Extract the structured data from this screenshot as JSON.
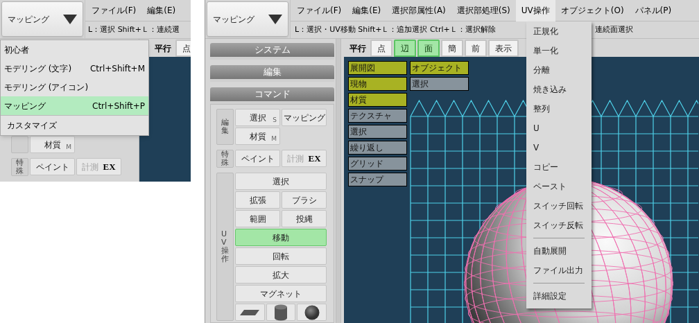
{
  "left_view": {
    "mode_button": {
      "label": "マッピング"
    },
    "menu_bar": [
      {
        "label": "ファイル(F)",
        "selected": false
      },
      {
        "label": "編集(E)",
        "selected": false
      }
    ],
    "status": [
      "L：選択  Shift+Ｌ：連続選"
    ],
    "view_tabs": [
      {
        "label": "平行",
        "kind": "label"
      },
      {
        "label": "点",
        "kind": "tab",
        "selected": false
      }
    ],
    "command_groups": [
      {
        "rows": [
          [
            {
              "label": "材質",
              "sub": "M",
              "kind": "text",
              "selected": false,
              "disabled": false
            }
          ]
        ]
      },
      {
        "label": "特殊",
        "rows": [
          [
            {
              "label": "ペイント",
              "kind": "text",
              "selected": false,
              "disabled": false
            },
            {
              "label": "計測",
              "badge": "EX",
              "kind": "text",
              "selected": false,
              "disabled": true
            }
          ]
        ]
      }
    ],
    "mode_menu": {
      "items": [
        {
          "label": "初心者",
          "selected": false
        },
        {
          "label": "モデリング (文字)",
          "shortcut": "Ctrl+Shift+M",
          "selected": false
        },
        {
          "label": "モデリング (アイコン)",
          "selected": false
        },
        {
          "label": "マッピング",
          "shortcut": "Ctrl+Shift+P",
          "selected": true
        }
      ],
      "footer": "カスタマイズ"
    }
  },
  "right_view": {
    "mode_button": {
      "label": "マッピング"
    },
    "menu_bar": [
      {
        "label": "ファイル(F)",
        "selected": false
      },
      {
        "label": "編集(E)",
        "selected": false
      },
      {
        "label": "選択部属性(A)",
        "selected": false
      },
      {
        "label": "選択部処理(S)",
        "selected": false
      },
      {
        "label": "UV操作",
        "selected": true
      },
      {
        "label": "オブジェクト(O)",
        "selected": false
      },
      {
        "label": "パネル(P)",
        "selected": false
      }
    ],
    "status": [
      "L：選択・UV移動  Shift+Ｌ：追加選択  Ctrl+Ｌ：選択解除",
      "連続面選択"
    ],
    "sidebar_sections": [
      "システム",
      "編集",
      "コマンド"
    ],
    "command_groups": [
      {
        "label": "編集",
        "rows": [
          [
            {
              "label": "選択",
              "sub": "S",
              "kind": "text",
              "selected": false,
              "disabled": false
            },
            {
              "label": "マッピング",
              "kind": "text",
              "selected": false,
              "disabled": false
            }
          ],
          [
            {
              "label": "材質",
              "sub": "M",
              "kind": "text",
              "selected": false,
              "disabled": false
            }
          ]
        ]
      },
      {
        "label": "特殊",
        "rows": [
          [
            {
              "label": "ペイント",
              "kind": "text",
              "selected": false,
              "disabled": false
            },
            {
              "label": "計測",
              "badge": "EX",
              "kind": "text",
              "selected": false,
              "disabled": true
            }
          ]
        ]
      },
      {
        "label": "UV操作",
        "rows": [
          [
            {
              "label": "選択",
              "wide": true,
              "kind": "text",
              "selected": false,
              "disabled": false
            }
          ],
          [
            {
              "label": "拡張",
              "kind": "text",
              "selected": false,
              "disabled": false
            },
            {
              "label": "ブラシ",
              "kind": "text",
              "selected": false,
              "disabled": false
            }
          ],
          [
            {
              "label": "範囲",
              "kind": "text",
              "selected": false,
              "disabled": false
            },
            {
              "label": "投縄",
              "kind": "text",
              "selected": false,
              "disabled": false
            }
          ],
          [
            {
              "label": "移動",
              "wide": true,
              "kind": "text",
              "selected": true,
              "disabled": false
            }
          ],
          [
            {
              "label": "回転",
              "wide": true,
              "kind": "text",
              "selected": false,
              "disabled": false
            }
          ],
          [
            {
              "label": "拡大",
              "wide": true,
              "kind": "text",
              "selected": false,
              "disabled": false
            }
          ],
          [
            {
              "label": "マグネット",
              "wide": true,
              "kind": "text",
              "selected": false,
              "disabled": false
            }
          ],
          [
            {
              "kind": "icon",
              "selected": false,
              "disabled": false
            },
            {
              "kind": "icon",
              "selected": false,
              "disabled": false
            },
            {
              "kind": "icon",
              "selected": false,
              "disabled": false
            }
          ]
        ]
      }
    ],
    "view_tabs": [
      {
        "label": "平行",
        "kind": "label"
      },
      {
        "label": "点",
        "kind": "tab",
        "selected": false
      },
      {
        "label": "辺",
        "kind": "tab",
        "selected": true
      },
      {
        "label": "面",
        "kind": "tab",
        "selected": true
      },
      {
        "label": "簡",
        "kind": "tab",
        "selected": false
      },
      {
        "label": "前",
        "kind": "tab",
        "selected": false
      },
      {
        "label": "表示",
        "kind": "tab",
        "selected": false
      }
    ],
    "canvas_buttons": {
      "column_1": [
        {
          "label": "展開図",
          "on": true
        },
        {
          "label": "現物",
          "on": true
        },
        {
          "label": "材質",
          "on": true
        },
        {
          "label": "テクスチャ",
          "on": false
        },
        {
          "label": "選択",
          "on": false
        },
        {
          "label": "繰り返し",
          "on": false
        },
        {
          "label": "グリッド",
          "on": false
        },
        {
          "label": "スナップ",
          "on": false
        }
      ],
      "column_2": [
        {
          "label": "オブジェクト",
          "on": true
        },
        {
          "label": "選択",
          "on": false
        }
      ]
    },
    "uv_menu": [
      {
        "kind": "item",
        "label": "正規化"
      },
      {
        "kind": "item",
        "label": "単一化"
      },
      {
        "kind": "item",
        "label": "分離"
      },
      {
        "kind": "item",
        "label": "焼き込み"
      },
      {
        "kind": "item",
        "label": "整列"
      },
      {
        "kind": "item",
        "label": "U"
      },
      {
        "kind": "item",
        "label": "V"
      },
      {
        "kind": "item",
        "label": "コピー"
      },
      {
        "kind": "item",
        "label": "ペースト"
      },
      {
        "kind": "item",
        "label": "スイッチ回転"
      },
      {
        "kind": "item",
        "label": "スイッチ反転"
      },
      {
        "kind": "separator"
      },
      {
        "kind": "item",
        "label": "自動展開"
      },
      {
        "kind": "item",
        "label": "ファイル出力"
      },
      {
        "kind": "separator"
      },
      {
        "kind": "item",
        "label": "詳細設定"
      }
    ]
  }
}
